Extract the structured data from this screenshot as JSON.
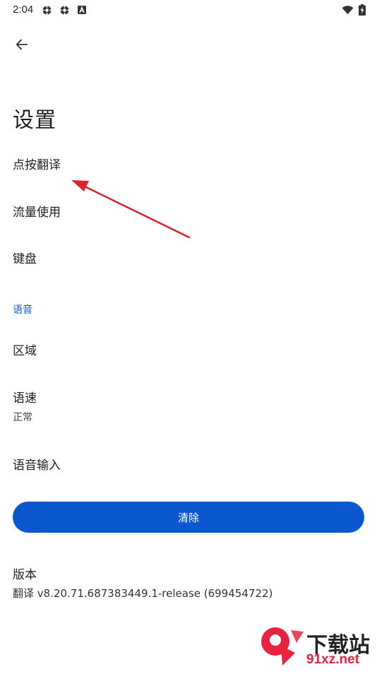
{
  "status_bar": {
    "time": "2:04",
    "left_icons": [
      "settings-gear-icon",
      "settings-gear-icon",
      "a-icon"
    ],
    "right_icons": [
      "wifi-icon",
      "battery-charging-icon"
    ]
  },
  "header": {
    "back_icon": "arrow-left-icon"
  },
  "page": {
    "title": "设置"
  },
  "settings": {
    "tap_to_translate": "点按翻译",
    "data_usage": "流量使用",
    "keyboard": "键盘",
    "voice_section": "语音",
    "region": "区域",
    "speech_rate": {
      "label": "语速",
      "value": "正常"
    },
    "voice_input": "语音输入",
    "clear_button": "清除",
    "version": {
      "label": "版本",
      "value": "翻译 v8.20.71.687383449.1-release (699454722)"
    }
  },
  "watermark": {
    "text": "下载站",
    "url": "91xz.net"
  },
  "colors": {
    "accent": "#0b57d0",
    "annotation_arrow": "#d9252a",
    "watermark_red": "#e8233f"
  }
}
